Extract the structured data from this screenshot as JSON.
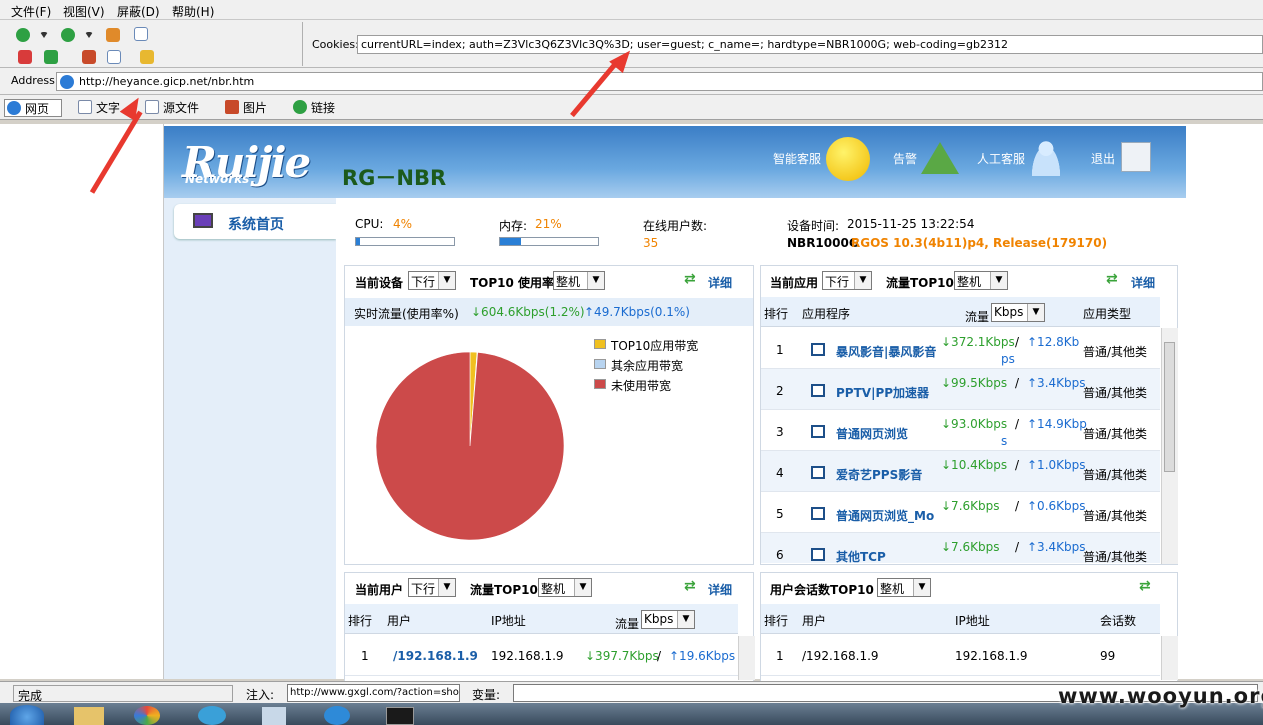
{
  "menu": [
    "文件(F)",
    "视图(V)",
    "屏蔽(D)",
    "帮助(H)"
  ],
  "cookies": {
    "label": "Cookies:",
    "value": "currentURL=index; auth=Z3Vlc3Q6Z3Vlc3Q%3D; user=guest; c_name=; hardtype=NBR1000G; web-coding=gb2312"
  },
  "address": {
    "label": "Address:",
    "value": "http://heyance.gicp.net/nbr.htm"
  },
  "tabs": [
    "网页",
    "文字",
    "源文件",
    "图片",
    "链接"
  ],
  "header": {
    "logo": "Ruijie",
    "logo_sub": "Networks",
    "model": "RG－NBR",
    "links": [
      "智能客服",
      "告警",
      "人工客服",
      "退出"
    ]
  },
  "sidebar": {
    "item": "系统首页"
  },
  "status": {
    "cpu_label": "CPU:",
    "cpu_value": "4%",
    "cpu_pct": 4,
    "mem_label": "内存:",
    "mem_value": "21%",
    "mem_pct": 21,
    "users_label": "在线用户数:",
    "users_value": "35",
    "time_label": "设备时间:",
    "time_value": "2015-11-25 13:22:54",
    "device": "NBR1000G",
    "version": "RGOS 10.3(4b11)p4, Release(179170)"
  },
  "device_panel": {
    "title": "当前设备",
    "direction": "下行",
    "top_label": "TOP10 使用率",
    "scope": "整机",
    "detail": "详细",
    "traffic_label": "实时流量(使用率%)",
    "down": "↓604.6Kbps(1.2%)",
    "up": "↑49.7Kbps(0.1%)",
    "legend": [
      "TOP10应用带宽",
      "其余应用带宽",
      "未使用带宽"
    ]
  },
  "chart_data": {
    "type": "pie",
    "labels": [
      "TOP10应用带宽",
      "其余应用带宽",
      "未使用带宽"
    ],
    "values": [
      1.2,
      0.1,
      98.7
    ],
    "colors": [
      "#f0c020",
      "#b8d4f0",
      "#cc4a4a"
    ],
    "legend": "top-right"
  },
  "app_panel": {
    "title": "当前应用",
    "direction": "下行",
    "top_label": "流量TOP10",
    "scope": "整机",
    "detail": "详细",
    "headers": [
      "排行",
      "应用程序",
      "流量",
      "应用类型"
    ],
    "unit": "Kbps",
    "rows": [
      {
        "rank": "1",
        "name": "暴风影音|暴风影音",
        "down": "↓372.1Kbps",
        "up": "↑12.8Kb",
        "up2": "ps",
        "type": "普通/其他类"
      },
      {
        "rank": "2",
        "name": "PPTV|PP加速器",
        "down": "↓99.5Kbps",
        "up": "↑3.4Kbps",
        "up2": "",
        "type": "普通/其他类"
      },
      {
        "rank": "3",
        "name": "普通网页浏览",
        "down": "↓93.0Kbps",
        "up": "↑14.9Kbp",
        "up2": "s",
        "type": "普通/其他类"
      },
      {
        "rank": "4",
        "name": "爱奇艺PPS影音",
        "down": "↓10.4Kbps",
        "up": "↑1.0Kbps",
        "up2": "",
        "type": "普通/其他类"
      },
      {
        "rank": "5",
        "name": "普通网页浏览_Mo",
        "down": "↓7.6Kbps",
        "up": "↑0.6Kbps",
        "up2": "",
        "type": "普通/其他类"
      },
      {
        "rank": "6",
        "name": "其他TCP",
        "down": "↓7.6Kbps",
        "up": "↑3.4Kbps",
        "up2": "",
        "type": "普通/其他类"
      }
    ]
  },
  "user_panel": {
    "title": "当前用户",
    "direction": "下行",
    "top_label": "流量TOP10",
    "scope": "整机",
    "detail": "详细",
    "headers": [
      "排行",
      "用户",
      "IP地址",
      "流量"
    ],
    "unit": "Kbps",
    "rows": [
      {
        "rank": "1",
        "user": "/192.168.1.9",
        "ip": "192.168.1.9",
        "down": "↓397.7Kbps",
        "up": "↑19.6Kbps"
      }
    ]
  },
  "session_panel": {
    "title": "用户会话数TOP10",
    "scope": "整机",
    "headers": [
      "排行",
      "用户",
      "IP地址",
      "会话数"
    ],
    "rows": [
      {
        "rank": "1",
        "user": "/192.168.1.9",
        "ip": "192.168.1.9",
        "count": "99"
      }
    ]
  },
  "statusbar": {
    "status": "完成",
    "inject_label": "注入:",
    "inject_value": "http://www.gxgl.com/?action=show",
    "var_label": "变量:"
  },
  "watermark": "www.wooyun.org",
  "separator": "/"
}
